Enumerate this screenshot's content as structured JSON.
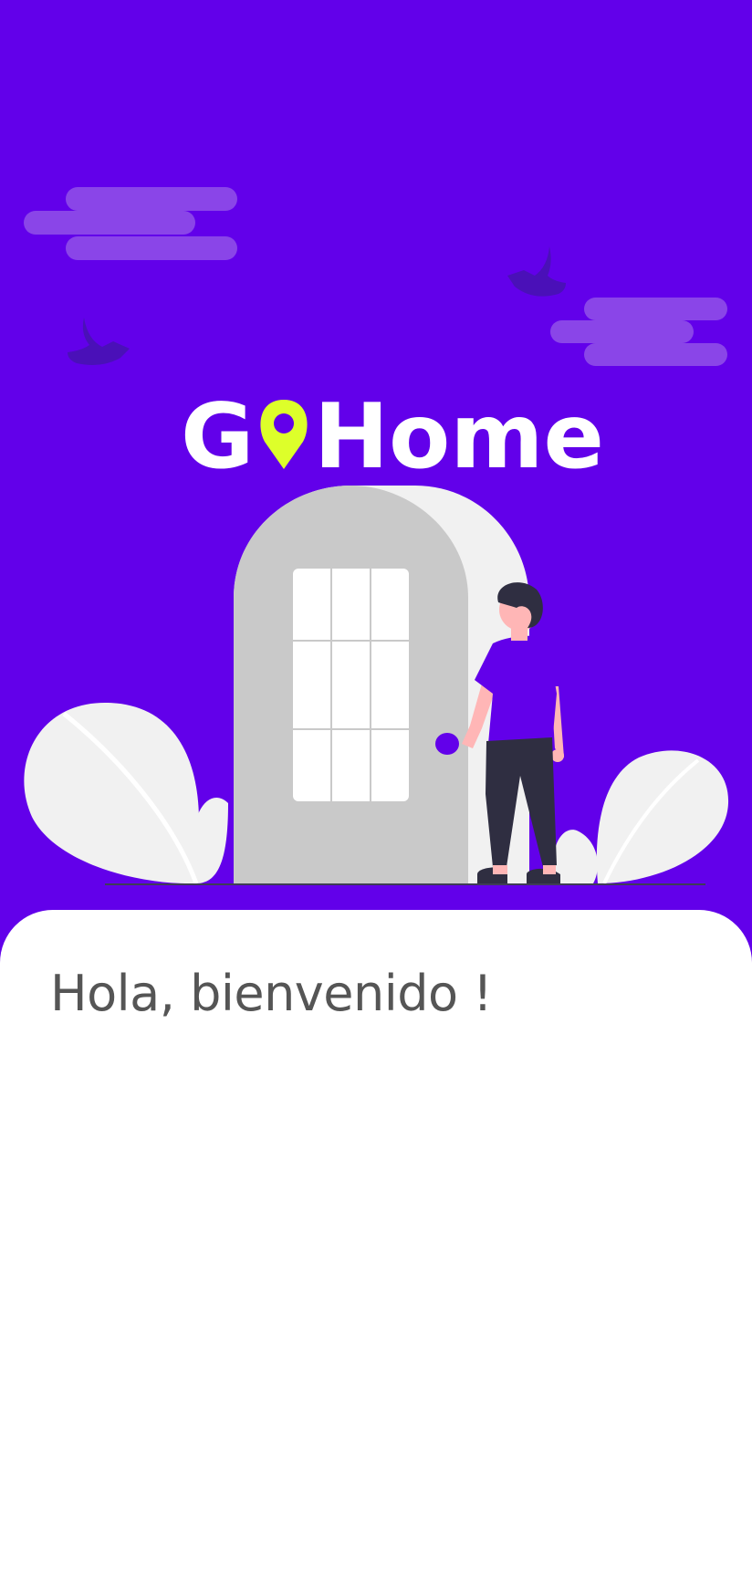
{
  "app": {
    "logo_prefix": "G",
    "logo_suffix": "Home"
  },
  "welcome": {
    "greeting": "Hola, bienvenido !"
  },
  "colors": {
    "primary": "#6200EA",
    "accent": "#DDFF2A",
    "cloud": "#8A45E8",
    "bird": "#4A10B8",
    "door": "#C9C9C9",
    "door_frame": "#F1F1F1",
    "bush": "#F1F1F1",
    "text": "#555555",
    "sheet": "#FFFFFF"
  },
  "icons": {
    "logo_pin": "location-pin-icon"
  }
}
